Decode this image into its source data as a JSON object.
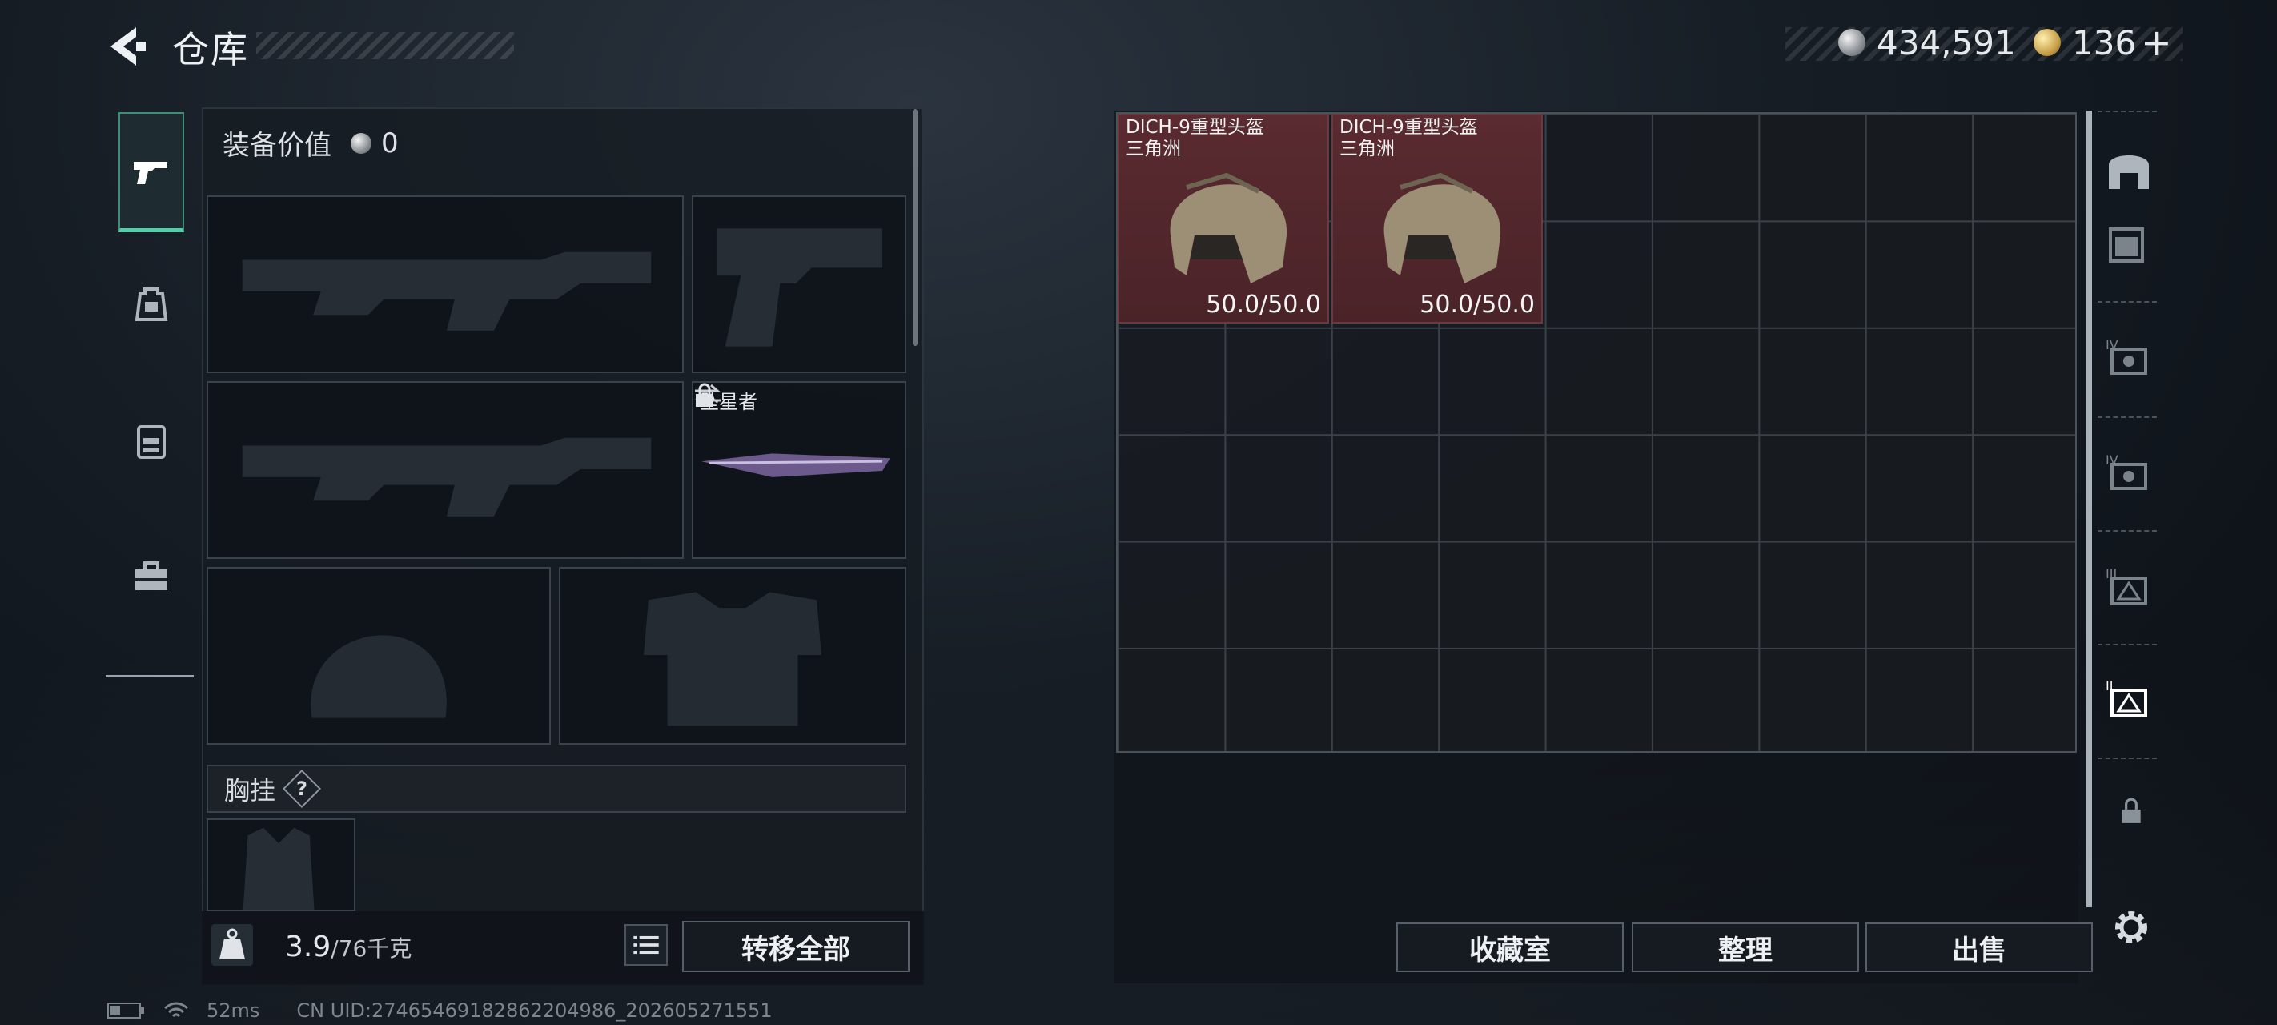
{
  "header": {
    "title": "仓库",
    "back_icon": "back-arrow-icon"
  },
  "currency": {
    "silver_amount": "434,591",
    "gold_amount": "136",
    "gold_add": "+"
  },
  "left_tabs": [
    {
      "name": "weapons-tab",
      "icon": "pistol-icon",
      "active": true
    },
    {
      "name": "backpack-tab",
      "icon": "backpack-icon",
      "active": false
    },
    {
      "name": "vest-tab",
      "icon": "vest-icon",
      "active": false
    },
    {
      "name": "toolbox-tab",
      "icon": "toolbox-icon",
      "active": false
    }
  ],
  "loadout": {
    "equipment_value_label": "装备价值",
    "equipment_value": "0",
    "melee_name": "坠星者",
    "chest_rig_label": "胸挂",
    "help_symbol": "?"
  },
  "footer": {
    "weight_value": "3.9",
    "weight_max": "/76千克",
    "transfer_all": "转移全部"
  },
  "stash_items": [
    {
      "name": "DICH-9重型头盔",
      "source": "三角洲",
      "durability": "50.0/50.0"
    },
    {
      "name": "DICH-9重型头盔",
      "source": "三角洲",
      "durability": "50.0/50.0"
    }
  ],
  "actions": {
    "collection": "收藏室",
    "organize": "整理",
    "sell": "出售"
  },
  "status_bar": {
    "ping": "52ms",
    "uid": "CN UID:274654691828622049​86_202605271551"
  },
  "colors": {
    "accent": "#4fd0a8",
    "item_bg": "#5a2b30"
  }
}
